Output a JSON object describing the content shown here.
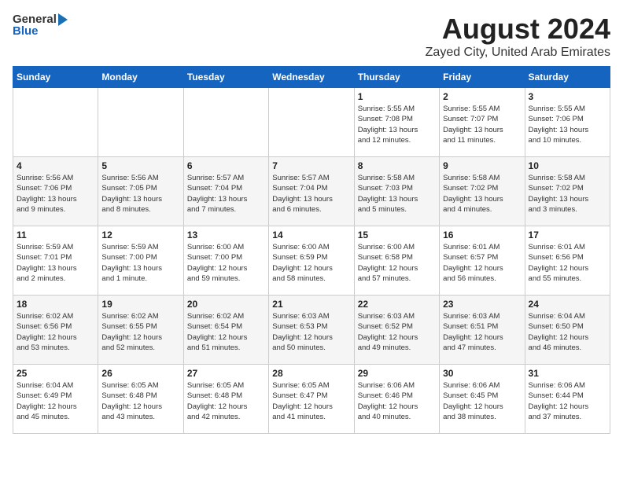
{
  "header": {
    "logo_general": "General",
    "logo_blue": "Blue",
    "title": "August 2024",
    "subtitle": "Zayed City, United Arab Emirates"
  },
  "calendar": {
    "weekdays": [
      "Sunday",
      "Monday",
      "Tuesday",
      "Wednesday",
      "Thursday",
      "Friday",
      "Saturday"
    ],
    "weeks": [
      [
        {
          "day": "",
          "info": ""
        },
        {
          "day": "",
          "info": ""
        },
        {
          "day": "",
          "info": ""
        },
        {
          "day": "",
          "info": ""
        },
        {
          "day": "1",
          "info": "Sunrise: 5:55 AM\nSunset: 7:08 PM\nDaylight: 13 hours\nand 12 minutes."
        },
        {
          "day": "2",
          "info": "Sunrise: 5:55 AM\nSunset: 7:07 PM\nDaylight: 13 hours\nand 11 minutes."
        },
        {
          "day": "3",
          "info": "Sunrise: 5:55 AM\nSunset: 7:06 PM\nDaylight: 13 hours\nand 10 minutes."
        }
      ],
      [
        {
          "day": "4",
          "info": "Sunrise: 5:56 AM\nSunset: 7:06 PM\nDaylight: 13 hours\nand 9 minutes."
        },
        {
          "day": "5",
          "info": "Sunrise: 5:56 AM\nSunset: 7:05 PM\nDaylight: 13 hours\nand 8 minutes."
        },
        {
          "day": "6",
          "info": "Sunrise: 5:57 AM\nSunset: 7:04 PM\nDaylight: 13 hours\nand 7 minutes."
        },
        {
          "day": "7",
          "info": "Sunrise: 5:57 AM\nSunset: 7:04 PM\nDaylight: 13 hours\nand 6 minutes."
        },
        {
          "day": "8",
          "info": "Sunrise: 5:58 AM\nSunset: 7:03 PM\nDaylight: 13 hours\nand 5 minutes."
        },
        {
          "day": "9",
          "info": "Sunrise: 5:58 AM\nSunset: 7:02 PM\nDaylight: 13 hours\nand 4 minutes."
        },
        {
          "day": "10",
          "info": "Sunrise: 5:58 AM\nSunset: 7:02 PM\nDaylight: 13 hours\nand 3 minutes."
        }
      ],
      [
        {
          "day": "11",
          "info": "Sunrise: 5:59 AM\nSunset: 7:01 PM\nDaylight: 13 hours\nand 2 minutes."
        },
        {
          "day": "12",
          "info": "Sunrise: 5:59 AM\nSunset: 7:00 PM\nDaylight: 13 hours\nand 1 minute."
        },
        {
          "day": "13",
          "info": "Sunrise: 6:00 AM\nSunset: 7:00 PM\nDaylight: 12 hours\nand 59 minutes."
        },
        {
          "day": "14",
          "info": "Sunrise: 6:00 AM\nSunset: 6:59 PM\nDaylight: 12 hours\nand 58 minutes."
        },
        {
          "day": "15",
          "info": "Sunrise: 6:00 AM\nSunset: 6:58 PM\nDaylight: 12 hours\nand 57 minutes."
        },
        {
          "day": "16",
          "info": "Sunrise: 6:01 AM\nSunset: 6:57 PM\nDaylight: 12 hours\nand 56 minutes."
        },
        {
          "day": "17",
          "info": "Sunrise: 6:01 AM\nSunset: 6:56 PM\nDaylight: 12 hours\nand 55 minutes."
        }
      ],
      [
        {
          "day": "18",
          "info": "Sunrise: 6:02 AM\nSunset: 6:56 PM\nDaylight: 12 hours\nand 53 minutes."
        },
        {
          "day": "19",
          "info": "Sunrise: 6:02 AM\nSunset: 6:55 PM\nDaylight: 12 hours\nand 52 minutes."
        },
        {
          "day": "20",
          "info": "Sunrise: 6:02 AM\nSunset: 6:54 PM\nDaylight: 12 hours\nand 51 minutes."
        },
        {
          "day": "21",
          "info": "Sunrise: 6:03 AM\nSunset: 6:53 PM\nDaylight: 12 hours\nand 50 minutes."
        },
        {
          "day": "22",
          "info": "Sunrise: 6:03 AM\nSunset: 6:52 PM\nDaylight: 12 hours\nand 49 minutes."
        },
        {
          "day": "23",
          "info": "Sunrise: 6:03 AM\nSunset: 6:51 PM\nDaylight: 12 hours\nand 47 minutes."
        },
        {
          "day": "24",
          "info": "Sunrise: 6:04 AM\nSunset: 6:50 PM\nDaylight: 12 hours\nand 46 minutes."
        }
      ],
      [
        {
          "day": "25",
          "info": "Sunrise: 6:04 AM\nSunset: 6:49 PM\nDaylight: 12 hours\nand 45 minutes."
        },
        {
          "day": "26",
          "info": "Sunrise: 6:05 AM\nSunset: 6:48 PM\nDaylight: 12 hours\nand 43 minutes."
        },
        {
          "day": "27",
          "info": "Sunrise: 6:05 AM\nSunset: 6:48 PM\nDaylight: 12 hours\nand 42 minutes."
        },
        {
          "day": "28",
          "info": "Sunrise: 6:05 AM\nSunset: 6:47 PM\nDaylight: 12 hours\nand 41 minutes."
        },
        {
          "day": "29",
          "info": "Sunrise: 6:06 AM\nSunset: 6:46 PM\nDaylight: 12 hours\nand 40 minutes."
        },
        {
          "day": "30",
          "info": "Sunrise: 6:06 AM\nSunset: 6:45 PM\nDaylight: 12 hours\nand 38 minutes."
        },
        {
          "day": "31",
          "info": "Sunrise: 6:06 AM\nSunset: 6:44 PM\nDaylight: 12 hours\nand 37 minutes."
        }
      ]
    ]
  }
}
